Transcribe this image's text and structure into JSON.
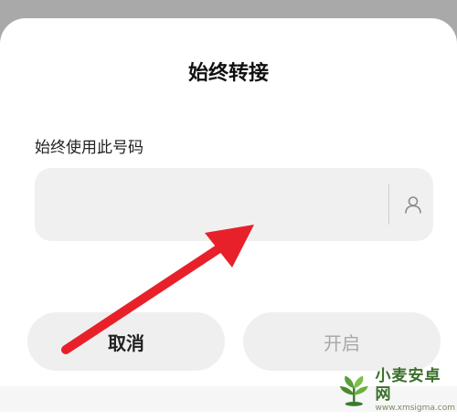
{
  "dialog": {
    "title": "始终转接",
    "field_label": "始终使用此号码",
    "field_value": "",
    "cancel_label": "取消",
    "open_label": "开启"
  },
  "watermark": {
    "title": "小麦安卓网",
    "url": "www.xmsigma.com"
  },
  "icons": {
    "contact": "person-icon"
  },
  "colors": {
    "arrow": "#e8202a",
    "field_bg": "#f0f0f0",
    "button_bg": "#efefef",
    "disabled_text": "#a8a8a8"
  }
}
